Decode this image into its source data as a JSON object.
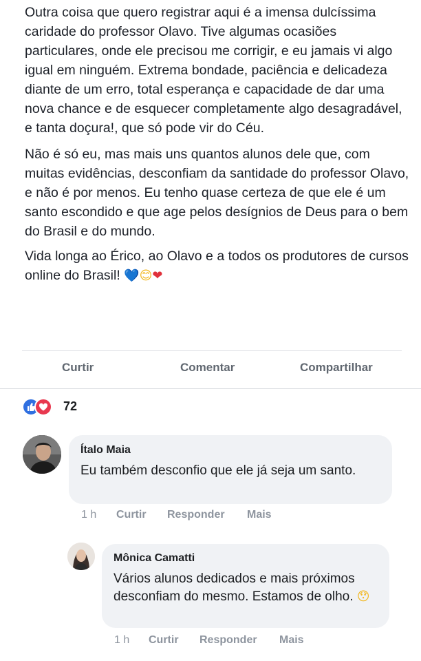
{
  "post": {
    "paragraphs": [
      "Outra coisa que quero registrar aqui é a imensa dulcíssima caridade do professor Olavo. Tive algumas ocasiões particulares, onde ele precisou me corrigir, e eu jamais vi algo igual em ninguém. Extrema bondade, paciência e delicadeza diante de um erro, total esperança e capacidade de dar uma nova chance e de esquecer completamente algo desagradável, e tanta doçura!, que só pode vir do Céu.",
      "Não é só eu, mas mais uns quantos alunos dele que, com muitas evidências, desconfiam da santidade do professor Olavo, e não é por menos. Eu tenho quase certeza de que ele é um santo escondido e que age pelos desígnios de Deus para o bem do Brasil e do mundo.",
      "Vida longa ao Érico, ao Olavo e a todos os produtores de cursos online do Brasil!"
    ],
    "trailing_emojis": [
      "💙",
      "😊",
      "❤"
    ]
  },
  "actions": {
    "like": "Curtir",
    "comment": "Comentar",
    "share": "Compartilhar"
  },
  "reactions": {
    "icons": [
      "like-icon",
      "love-icon"
    ],
    "count": "72"
  },
  "comments": [
    {
      "author": "Ítalo Maia",
      "text": "Eu também desconfio que ele já seja um santo.",
      "time": "1 h",
      "like": "Curtir",
      "reply": "Responder",
      "more": "Mais"
    },
    {
      "author": "Mônica Camatti",
      "text": "Vários alunos dedicados e mais próximos desconfiam do mesmo. Estamos de olho.",
      "emoji": "😯",
      "time": "1 h",
      "like": "Curtir",
      "reply": "Responder",
      "more": "Mais"
    }
  ],
  "colors": {
    "like_blue": "#2f6fe0",
    "love_red": "#e8384f",
    "bubble_bg": "#f0f2f5",
    "meta_gray": "#8d949e"
  }
}
